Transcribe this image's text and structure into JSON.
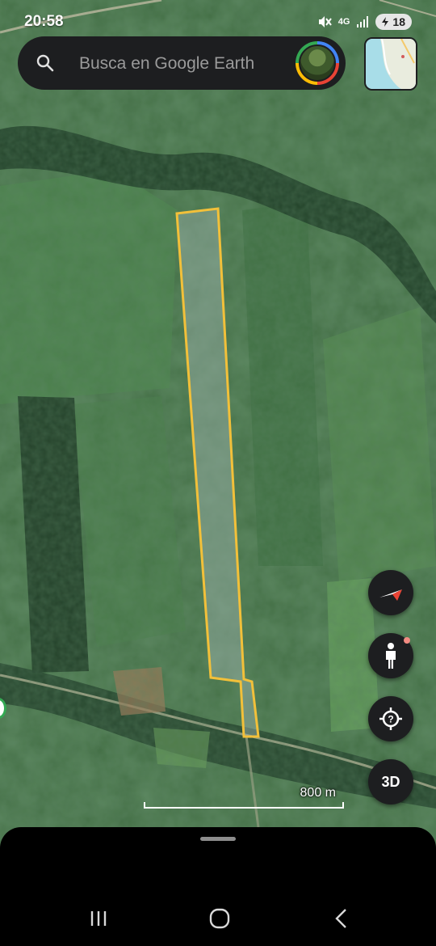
{
  "status_bar": {
    "time": "20:58",
    "network": "4G",
    "battery": "18"
  },
  "search": {
    "placeholder": "Busca en Google Earth"
  },
  "map": {
    "type": "satellite",
    "polygon_outline_color": "#f2c03a",
    "scale_label": "800 m"
  },
  "controls": {
    "compass_icon": "compass-icon",
    "pegman_icon": "street-view-icon",
    "locate_icon": "my-location-icon",
    "threed_label": "3D"
  },
  "nav": {
    "recent_icon": "recent-apps-icon",
    "home_icon": "home-icon",
    "back_icon": "back-icon"
  }
}
